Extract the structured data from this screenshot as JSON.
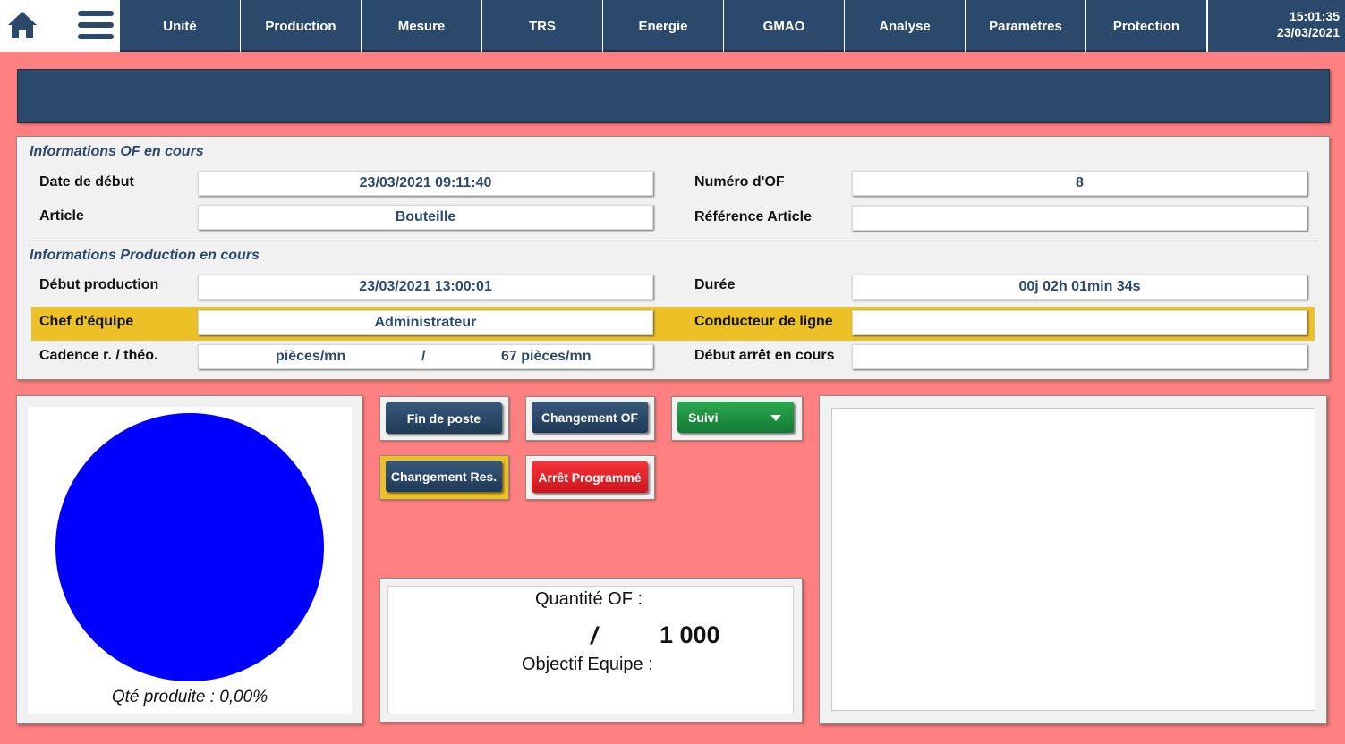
{
  "topbar": {
    "nav": [
      "Unité",
      "Production",
      "Mesure",
      "TRS",
      "Energie",
      "GMAO",
      "Analyse",
      "Paramètres",
      "Protection"
    ],
    "time": "15:01:35",
    "date": "23/03/2021"
  },
  "of_info": {
    "title": "Informations OF en cours",
    "date_debut_label": "Date de début",
    "date_debut_value": "23/03/2021 09:11:40",
    "numero_of_label": "Numéro d'OF",
    "numero_of_value": "8",
    "article_label": "Article",
    "article_value": "Bouteille",
    "ref_article_label": "Référence Article",
    "ref_article_value": ""
  },
  "production_info": {
    "title": "Informations Production en cours",
    "debut_production_label": "Début production",
    "debut_production_value": "23/03/2021 13:00:01",
    "duree_label": "Durée",
    "duree_value": "00j 02h 01min 34s",
    "chef_equipe_label": "Chef d'équipe",
    "chef_equipe_value": "Administrateur",
    "conducteur_label": "Conducteur de ligne",
    "conducteur_value": "",
    "cadence_label": "Cadence r. / théo.",
    "cadence_reelle": "pièces/mn",
    "cadence_sep": "/",
    "cadence_theorique": "67 pièces/mn",
    "debut_arret_label": "Début arrêt en cours",
    "debut_arret_value": ""
  },
  "pie": {
    "caption": "Qté produite : 0,00%",
    "produced_percent": 0,
    "color": "#0000ff"
  },
  "buttons": {
    "fin_de_poste": "Fin de poste",
    "changement_of": "Changement OF",
    "suivi": "Suivi",
    "changement_res": "Changement Res.",
    "arret_programme": "Arrêt Programmé"
  },
  "quantity": {
    "quantite_of_label": "Quantité OF :",
    "separator": "/",
    "total": "1 000",
    "objectif_label": "Objectif Equipe :"
  },
  "colors": {
    "background": "#ff8080",
    "navy": "#2b4a6b",
    "highlight_yellow": "#ecc128",
    "button_red": "#e0242a",
    "button_green": "#1f9142"
  },
  "icons": {
    "home": "home-icon",
    "menu": "hamburger-menu-icon",
    "dropdown": "caret-down-icon"
  }
}
